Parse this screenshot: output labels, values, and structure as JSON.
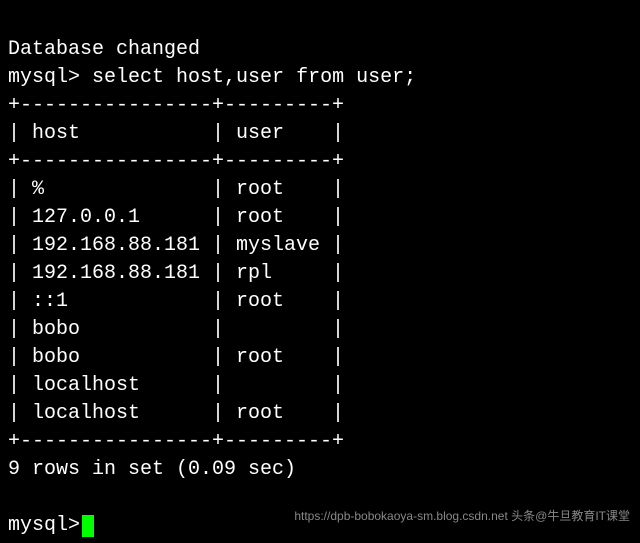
{
  "terminal": {
    "status_line": "Database changed",
    "prompt": "mysql>",
    "query": "select host,user from user;",
    "table_border_top": "+----------------+---------+",
    "table_border_mid": "+----------------+---------+",
    "table_border_bot": "+----------------+---------+",
    "header_row": "| host           | user    |",
    "rows": [
      "| %              | root    |",
      "| 127.0.0.1      | root    |",
      "| 192.168.88.181 | myslave |",
      "| 192.168.88.181 | rpl     |",
      "| ::1            | root    |",
      "| bobo           |         |",
      "| bobo           | root    |",
      "| localhost      |         |",
      "| localhost      | root    |"
    ],
    "result_summary": "9 rows in set (0.09 sec)",
    "data": {
      "columns": [
        "host",
        "user"
      ],
      "values": [
        [
          "%",
          "root"
        ],
        [
          "127.0.0.1",
          "root"
        ],
        [
          "192.168.88.181",
          "myslave"
        ],
        [
          "192.168.88.181",
          "rpl"
        ],
        [
          "::1",
          "root"
        ],
        [
          "bobo",
          ""
        ],
        [
          "bobo",
          "root"
        ],
        [
          "localhost",
          ""
        ],
        [
          "localhost",
          "root"
        ]
      ]
    }
  },
  "watermark": {
    "url": "https://dpb-bobokaoya-sm.blog.csdn.net",
    "brand": "头条@牛旦教育IT课堂"
  }
}
